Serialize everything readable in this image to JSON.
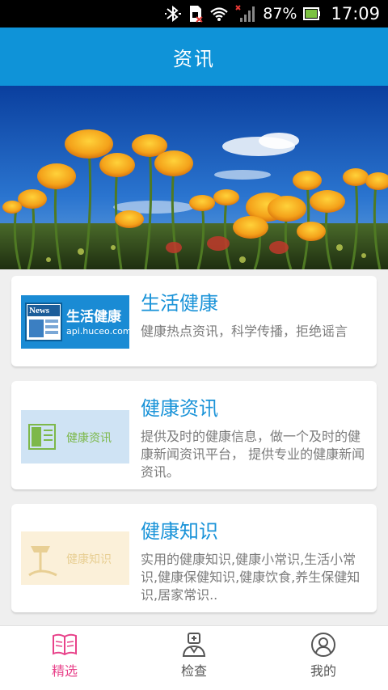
{
  "status_bar": {
    "battery": "87%",
    "time": "17:09"
  },
  "header": {
    "title": "资讯"
  },
  "banner": {
    "icon": "poppy-field-photo"
  },
  "cards": [
    {
      "title": "生活健康",
      "description": "健康热点资讯，科学传播，拒绝谣言",
      "thumb": {
        "badge": "News",
        "label": "生活健康",
        "url_text": "api.huceo.com"
      }
    },
    {
      "title": "健康资讯",
      "description": "提供及时的健康信息，做一个及时的健康新闻资讯平台， 提供专业的健康新闻资讯。",
      "thumb": {
        "label": "健康资讯"
      }
    },
    {
      "title": "健康知识",
      "description": "实用的健康知识,健康小常识,生活小常识,健康保健知识,健康饮食,养生保健知识,居家常识..",
      "thumb": {
        "label": "健康知识"
      }
    }
  ],
  "bottom_nav": [
    {
      "label": "精选",
      "icon": "book-icon",
      "active": true
    },
    {
      "label": "检查",
      "icon": "doctor-icon",
      "active": false
    },
    {
      "label": "我的",
      "icon": "user-icon",
      "active": false
    }
  ],
  "colors": {
    "primary": "#0f93d8",
    "card_title": "#1a93d8",
    "active_tab": "#e8428a"
  }
}
